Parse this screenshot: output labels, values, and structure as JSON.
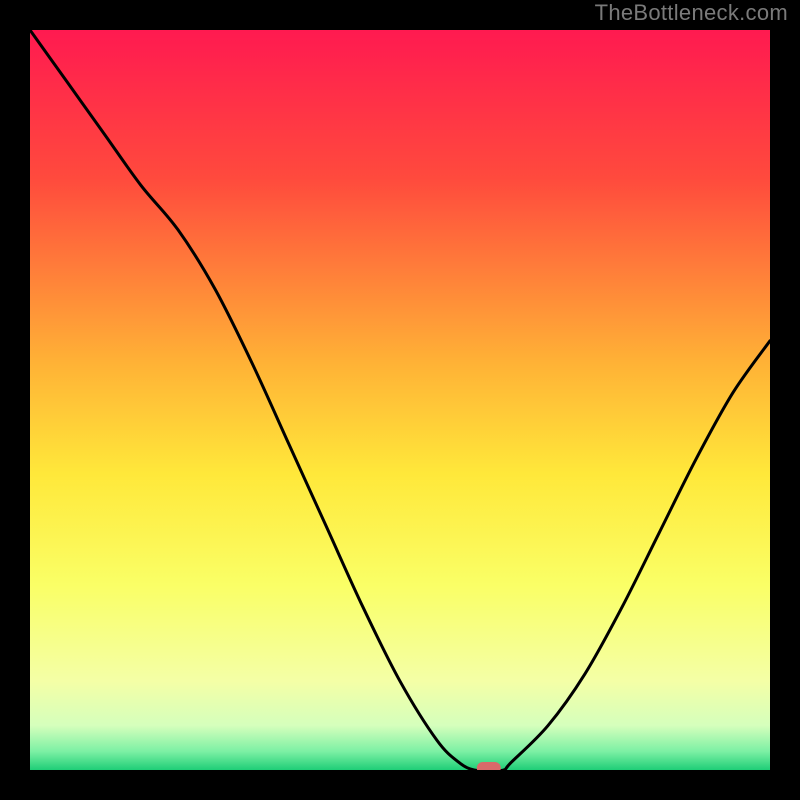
{
  "watermark": "TheBottleneck.com",
  "chart_data": {
    "type": "line",
    "title": "",
    "xlabel": "",
    "ylabel": "",
    "xlim": [
      0,
      100
    ],
    "ylim": [
      0,
      100
    ],
    "x": [
      0,
      5,
      10,
      15,
      20,
      25,
      30,
      35,
      40,
      45,
      50,
      55,
      58,
      60,
      62,
      64,
      65,
      70,
      75,
      80,
      85,
      90,
      95,
      100
    ],
    "values": [
      100,
      93,
      86,
      79,
      73,
      65,
      55,
      44,
      33,
      22,
      12,
      4,
      1,
      0,
      0,
      0,
      1,
      6,
      13,
      22,
      32,
      42,
      51,
      58
    ],
    "marker": {
      "x": 62,
      "y": 0
    },
    "gradient_stops": [
      {
        "pos": 0.0,
        "color": "#ff1a50"
      },
      {
        "pos": 0.2,
        "color": "#ff4a3d"
      },
      {
        "pos": 0.45,
        "color": "#ffb236"
      },
      {
        "pos": 0.6,
        "color": "#ffe83a"
      },
      {
        "pos": 0.75,
        "color": "#faff66"
      },
      {
        "pos": 0.88,
        "color": "#f4ffa6"
      },
      {
        "pos": 0.94,
        "color": "#d5ffbc"
      },
      {
        "pos": 0.975,
        "color": "#7cf0a4"
      },
      {
        "pos": 1.0,
        "color": "#1fce77"
      }
    ]
  }
}
